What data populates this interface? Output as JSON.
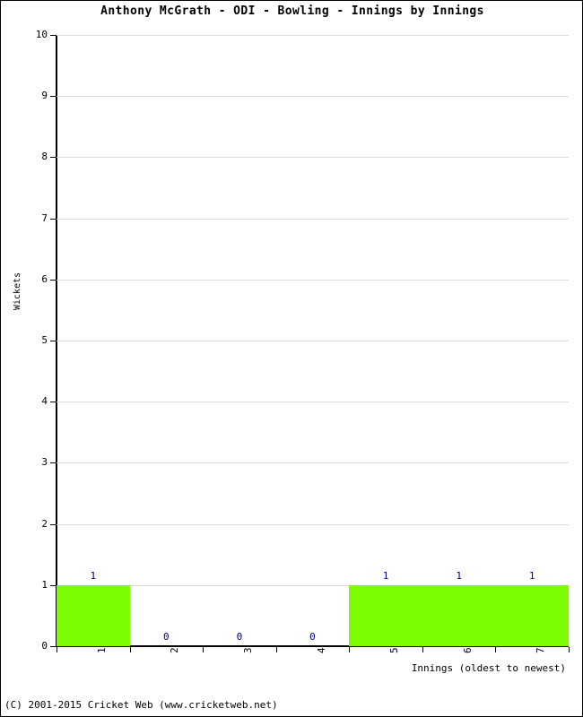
{
  "chart_data": {
    "type": "bar",
    "title": "Anthony McGrath - ODI - Bowling - Innings by Innings",
    "xlabel": "Innings (oldest to newest)",
    "ylabel": "Wickets",
    "categories": [
      "1",
      "2",
      "3",
      "4",
      "5",
      "6",
      "7"
    ],
    "values": [
      1,
      0,
      0,
      0,
      1,
      1,
      1
    ],
    "data_labels": [
      "1",
      "0",
      "0",
      "0",
      "1",
      "1",
      "1"
    ],
    "ylim": [
      0,
      10
    ],
    "ytick_labels": [
      "0",
      "1",
      "2",
      "3",
      "4",
      "5",
      "6",
      "7",
      "8",
      "9",
      "10"
    ],
    "ytick_values": [
      0,
      1,
      2,
      3,
      4,
      5,
      6,
      7,
      8,
      9,
      10
    ],
    "grid": true,
    "legend": false,
    "bar_color": "#7cfc00",
    "label_color": "#00008b",
    "grid_color": "#dcdcdc",
    "axis_color": "#000000"
  },
  "footer": {
    "copyright": "(C) 2001-2015 Cricket Web (www.cricketweb.net)"
  }
}
